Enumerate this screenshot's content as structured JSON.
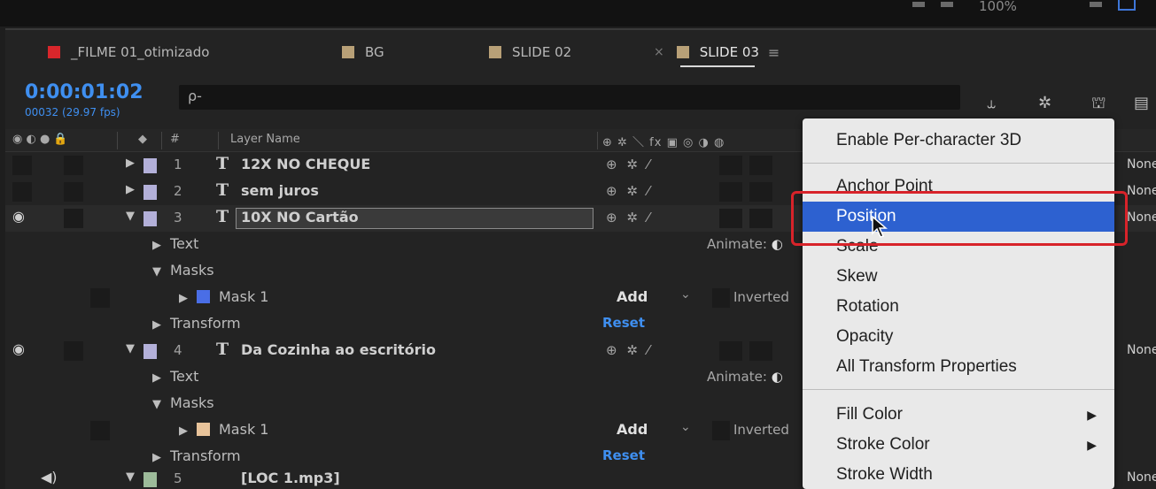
{
  "colors": {
    "accent_blue": "#3f8ff0",
    "menu_highlight": "#2d61d0",
    "annotation_red": "#d8232a",
    "tab_red": "#d8262b",
    "tab_tan": "#b8a077",
    "lavender": "#b3b0d9",
    "mask_blue": "#4a6ee6",
    "mask_peach": "#e8c39a"
  },
  "top_strip": {
    "zoom": "100%"
  },
  "tabs": [
    {
      "label": "_FILME 01_otimizado",
      "color": "#d8262b",
      "active": false
    },
    {
      "label": "BG",
      "color": "#b8a077",
      "active": false
    },
    {
      "label": "SLIDE 02",
      "color": "#b8a077",
      "active": false
    },
    {
      "label": "SLIDE 03",
      "color": "#b8a077",
      "active": true,
      "close": "×",
      "menu": "≡"
    }
  ],
  "timeline": {
    "timecode": "0:00:01:02",
    "frames": "00032 (29.97 fps)",
    "search_placeholder": "",
    "search_icon": "ρ-"
  },
  "header": {
    "av_icons": "◉ ◐ ● 🔒",
    "label_icon": "tag-icon",
    "num": "#",
    "layer_name": "Layer Name",
    "switches": "⊕ ✲ ＼ fx ▣ ◎ ◑ ◍"
  },
  "layers": [
    {
      "num": "1",
      "type": "T",
      "name": "12X  NO CHEQUE",
      "switches": "⊕ ✲ ⁄",
      "parent": "None"
    },
    {
      "num": "2",
      "type": "T",
      "name": "sem juros",
      "switches": "⊕ ✲ ⁄",
      "parent": "None"
    },
    {
      "num": "3",
      "type": "T",
      "name": "10X  NO Cartão",
      "switches": "⊕ ✲ ⁄",
      "parent": "None"
    },
    {
      "num": "4",
      "type": "T",
      "name": "Da Cozinha ao escritório",
      "switches": "⊕ ✲ ⁄",
      "parent": "None"
    },
    {
      "num": "5",
      "type": "",
      "name": "[LOC 1.mp3]",
      "parent": "None"
    }
  ],
  "props": {
    "text": "Text",
    "masks": "Masks",
    "mask1": "Mask 1",
    "transform": "Transform",
    "animate": "Animate:",
    "add": "Add",
    "inverted": "Inverted",
    "reset": "Reset"
  },
  "menu": {
    "items": [
      "Enable Per-character 3D",
      "Anchor Point",
      "Position",
      "Scale",
      "Skew",
      "Rotation",
      "Opacity",
      "All Transform Properties",
      "Fill Color",
      "Stroke Color",
      "Stroke Width"
    ],
    "highlighted": "Position",
    "submenu_arrow": "▶"
  }
}
